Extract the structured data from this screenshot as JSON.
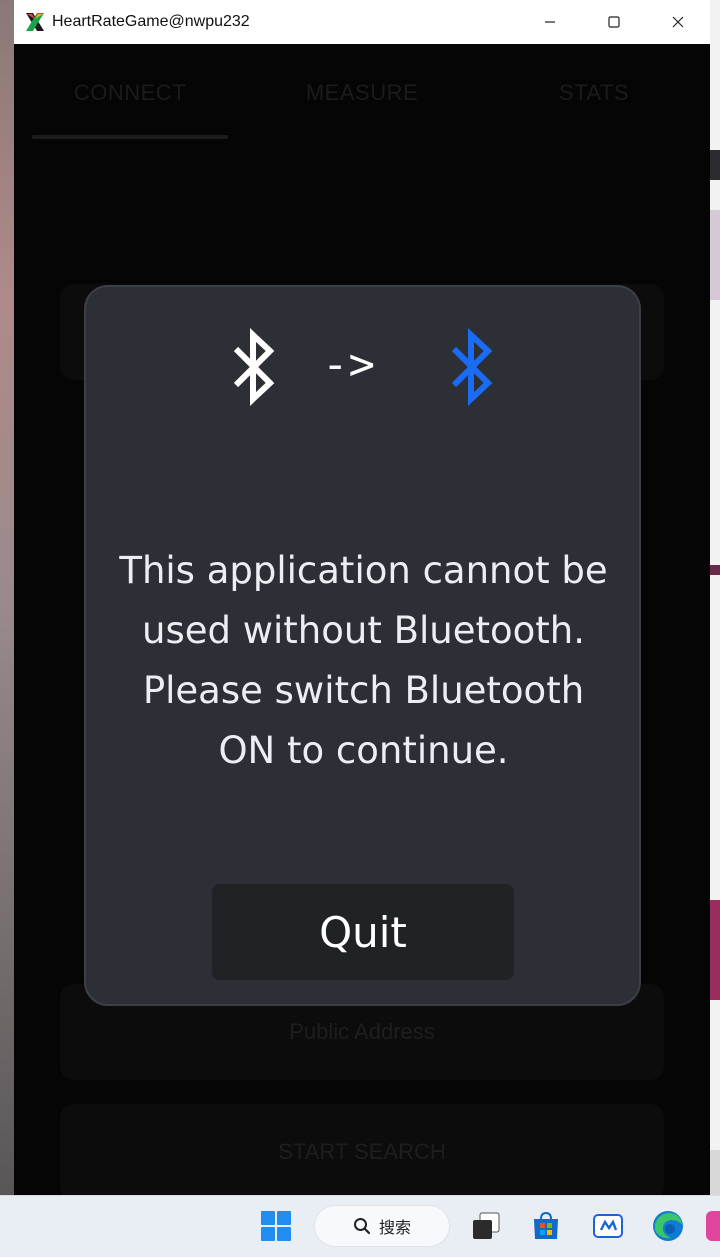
{
  "window": {
    "title": "HeartRateGame@nwpu232",
    "app_icon": "x-logo-icon"
  },
  "tabs": [
    {
      "label": "CONNECT",
      "selected": true
    },
    {
      "label": "MEASURE",
      "selected": false
    },
    {
      "label": "STATS",
      "selected": false
    }
  ],
  "background": {
    "public_address_label": "Public Address",
    "start_search_label": "START SEARCH"
  },
  "dialog": {
    "icons": [
      "bluetooth-off-icon",
      "bluetooth-on-icon"
    ],
    "arrow": "->",
    "message_lines": [
      "This application cannot be",
      "used without Bluetooth.",
      "Please switch Bluetooth",
      "ON to continue."
    ],
    "quit_label": "Quit",
    "colors": {
      "background": "#2d2f36",
      "bluetooth_on": "#1a6cf5",
      "bluetooth_off": "#ffffff"
    }
  },
  "taskbar": {
    "search_label": "搜索",
    "icons": [
      "windows-start-icon",
      "search-icon",
      "task-view-icon",
      "microsoft-store-icon",
      "remote-app-icon",
      "edge-browser-icon",
      "app-icon"
    ]
  }
}
